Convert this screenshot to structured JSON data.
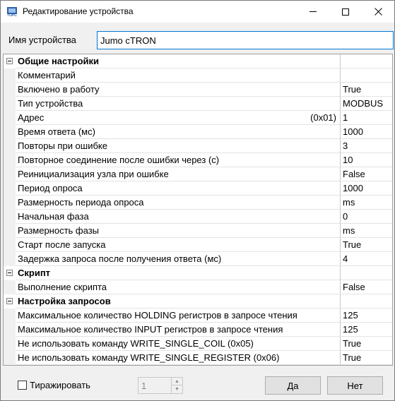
{
  "window": {
    "title": "Редактирование устройства",
    "icon_text": "ТОРС"
  },
  "name_field": {
    "label": "Имя устройства",
    "value": "Jumo cTRON"
  },
  "grid": {
    "rows": [
      {
        "type": "category",
        "name": "Общие настройки",
        "value": ""
      },
      {
        "type": "prop",
        "name": "Комментарий",
        "value": ""
      },
      {
        "type": "prop",
        "name": "Включено в работу",
        "value": "True"
      },
      {
        "type": "prop",
        "name": "Тип устройства",
        "value": "MODBUS"
      },
      {
        "type": "prop",
        "name": "Адрес",
        "hint": "(0x01)",
        "value": "1"
      },
      {
        "type": "prop",
        "name": "Время ответа (мс)",
        "value": "1000"
      },
      {
        "type": "prop",
        "name": "Повторы при ошибке",
        "value": "3"
      },
      {
        "type": "prop",
        "name": "Повторное соединение после ошибки через (с)",
        "value": "10"
      },
      {
        "type": "prop",
        "name": "Реинициализация узла при ошибке",
        "value": "False"
      },
      {
        "type": "prop",
        "name": "Период опроса",
        "value": "1000"
      },
      {
        "type": "prop",
        "name": "Размерность периода опроса",
        "value": "ms"
      },
      {
        "type": "prop",
        "name": "Начальная фаза",
        "value": "0"
      },
      {
        "type": "prop",
        "name": "Размерность фазы",
        "value": "ms"
      },
      {
        "type": "prop",
        "name": "Старт после запуска",
        "value": "True"
      },
      {
        "type": "prop",
        "name": "Задержка запроса после получения ответа (мс)",
        "value": "4"
      },
      {
        "type": "category",
        "name": "Скрипт",
        "value": ""
      },
      {
        "type": "prop",
        "name": "Выполнение скрипта",
        "value": "False"
      },
      {
        "type": "category",
        "name": "Настройка запросов",
        "value": ""
      },
      {
        "type": "prop",
        "name": "Максимальное количество HOLDING регистров в запросе чтения",
        "value": "125"
      },
      {
        "type": "prop",
        "name": "Максимальное количество INPUT регистров в запросе чтения",
        "value": "125"
      },
      {
        "type": "prop",
        "name": "Не использовать команду WRITE_SINGLE_COIL (0x05)",
        "value": "True"
      },
      {
        "type": "prop",
        "name": "Не использовать команду WRITE_SINGLE_REGISTER (0x06)",
        "value": "True"
      }
    ]
  },
  "footer": {
    "replicate_label": "Тиражировать",
    "replicate_checked": false,
    "count_value": "1",
    "ok_label": "Да",
    "cancel_label": "Нет"
  },
  "colors": {
    "accent_border": "#0078d7",
    "gridline": "#e3e3e3",
    "background": "#f0f0f0"
  }
}
